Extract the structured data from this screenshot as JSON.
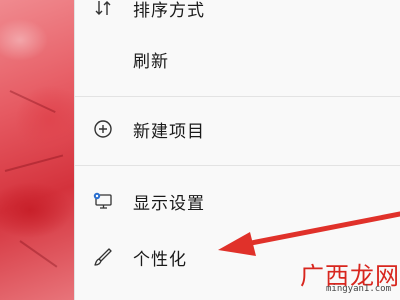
{
  "menu": {
    "items": [
      {
        "label": "排序方式",
        "icon": "sort-icon"
      },
      {
        "label": "刷新",
        "icon": ""
      },
      {
        "label": "新建项目",
        "icon": "add-circle-icon"
      },
      {
        "label": "显示设置",
        "icon": "display-settings-icon"
      },
      {
        "label": "个性化",
        "icon": "brush-icon"
      }
    ]
  },
  "watermark": {
    "title": "广西龙网",
    "url": "mingyan1.com"
  },
  "colors": {
    "arrow": "#e0312a",
    "wallpaper": "#e65a62",
    "watermark": "#d8261e"
  }
}
